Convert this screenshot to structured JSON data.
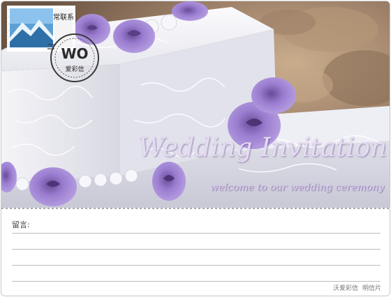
{
  "card": {
    "title": "Wedding Invitation",
    "subtitle": "welcome to our wedding ceremony",
    "stamp_text": "常联系",
    "postmark_text": "爱彩信",
    "postmark_logo": "WO"
  },
  "message": {
    "label": "留言:",
    "line_count": 4
  },
  "footer": {
    "brand": "沃爱彩信",
    "type": "明信片"
  },
  "colors": {
    "accent_lilac": "#e6dcf2",
    "flower_purple": "#8f72c9",
    "frosting_white": "#f2f2f6",
    "rule_gray": "#bdbdbd"
  },
  "icons": [
    "postage-stamp-icon",
    "postmark-icon"
  ]
}
